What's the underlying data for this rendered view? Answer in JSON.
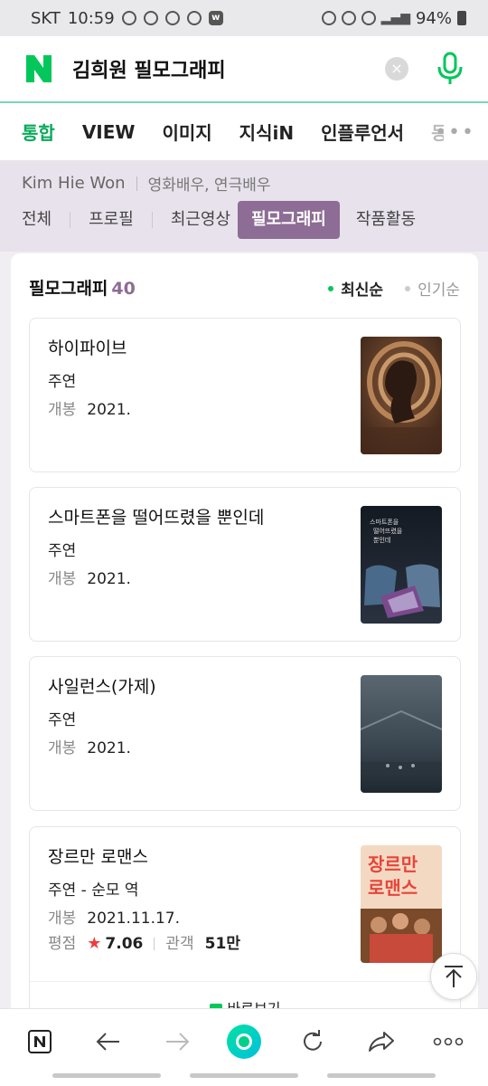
{
  "status_bar": {
    "carrier": "SKT",
    "time": "10:59",
    "badge_w": "w",
    "battery": "94%"
  },
  "search": {
    "logo": "N",
    "query": "김희원 필모그래피",
    "clear_icon": "×"
  },
  "tabs": [
    "통합",
    "VIEW",
    "이미지",
    "지식iN",
    "인플루언서",
    "동"
  ],
  "tabs_more": "•••",
  "profile": {
    "name": "Kim Hie Won",
    "role": "영화배우, 연극배우",
    "subtabs": [
      "전체",
      "프로필",
      "최근영상",
      "필모그래피",
      "작품활동"
    ],
    "active_subtab": "필모그래피"
  },
  "filmography": {
    "title": "필모그래피",
    "count": "40",
    "sort_latest": "최신순",
    "sort_popular": "인기순",
    "items": [
      {
        "title": "하이파이브",
        "role": "주연",
        "release_label": "개봉",
        "release": "2021."
      },
      {
        "title": "스마트폰을 떨어뜨렸을 뿐인데",
        "role": "주연",
        "release_label": "개봉",
        "release": "2021.",
        "poster_text": "스마트폰을\n떨어뜨렸을\n뿐인데"
      },
      {
        "title": "사일런스(가제)",
        "role": "주연",
        "release_label": "개봉",
        "release": "2021."
      },
      {
        "title": "장르만 로맨스",
        "role": "주연 - 순모 역",
        "release_label": "개봉",
        "release": "2021.11.17.",
        "rating_label": "평점",
        "rating": "7.06",
        "audience_label": "관객",
        "audience": "51만",
        "poster_text": "장르만\n로맨스",
        "shortcut": "바로보기"
      }
    ]
  },
  "colors": {
    "naver_green": "#03c75a",
    "accent_purple": "#8d6c95",
    "star_red": "#f03c3c"
  }
}
